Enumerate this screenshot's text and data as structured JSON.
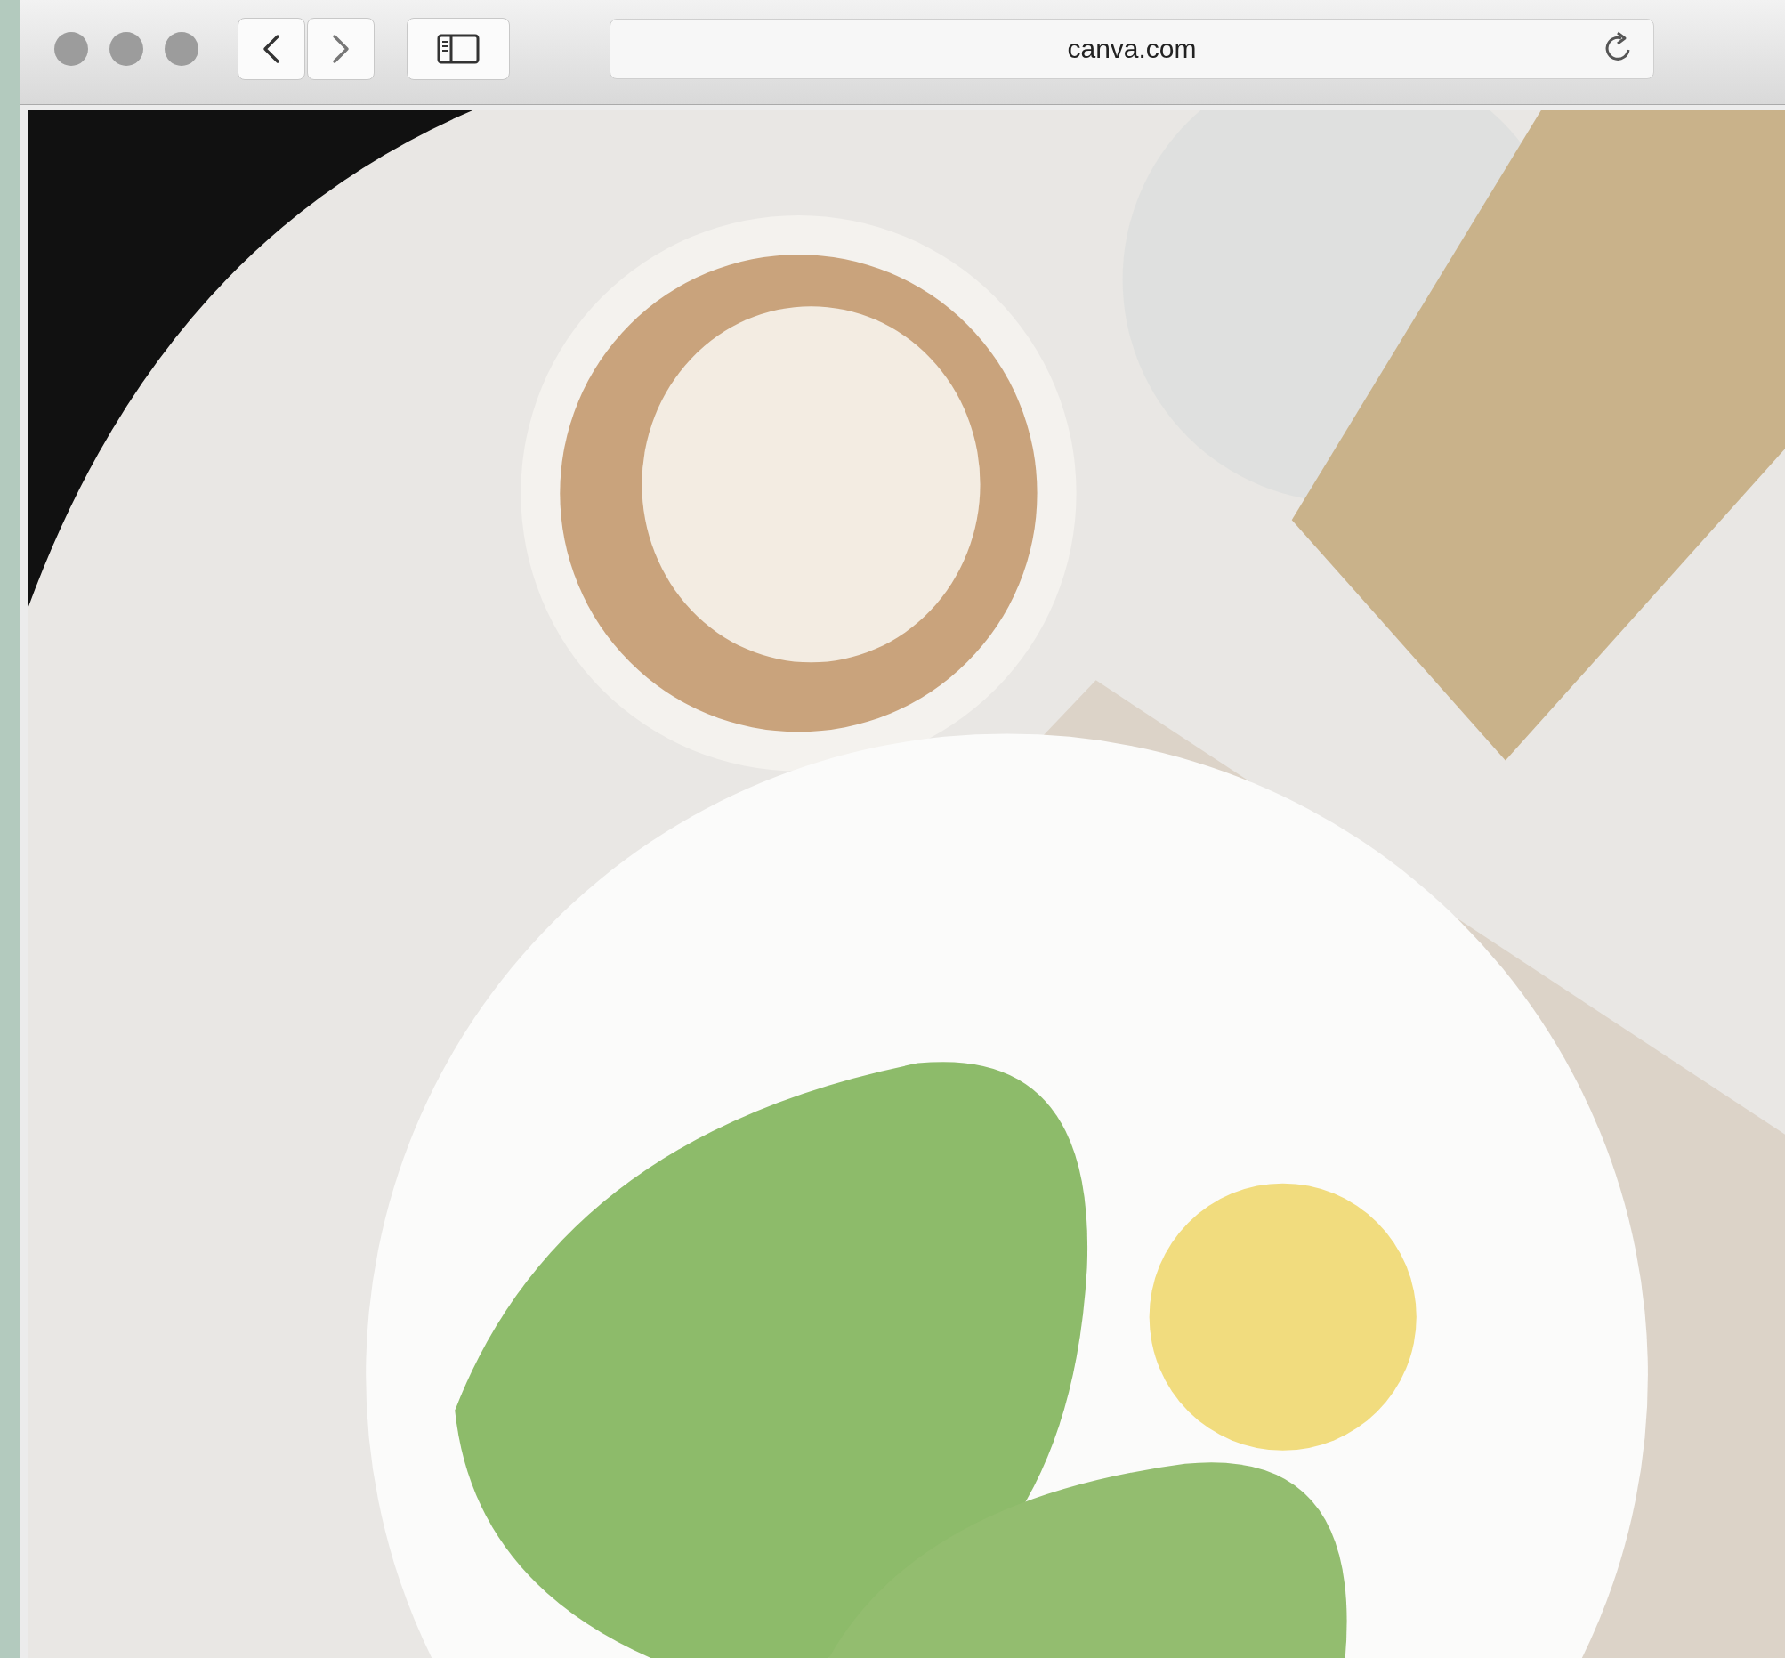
{
  "address_bar": {
    "url": "canva.com"
  }
}
